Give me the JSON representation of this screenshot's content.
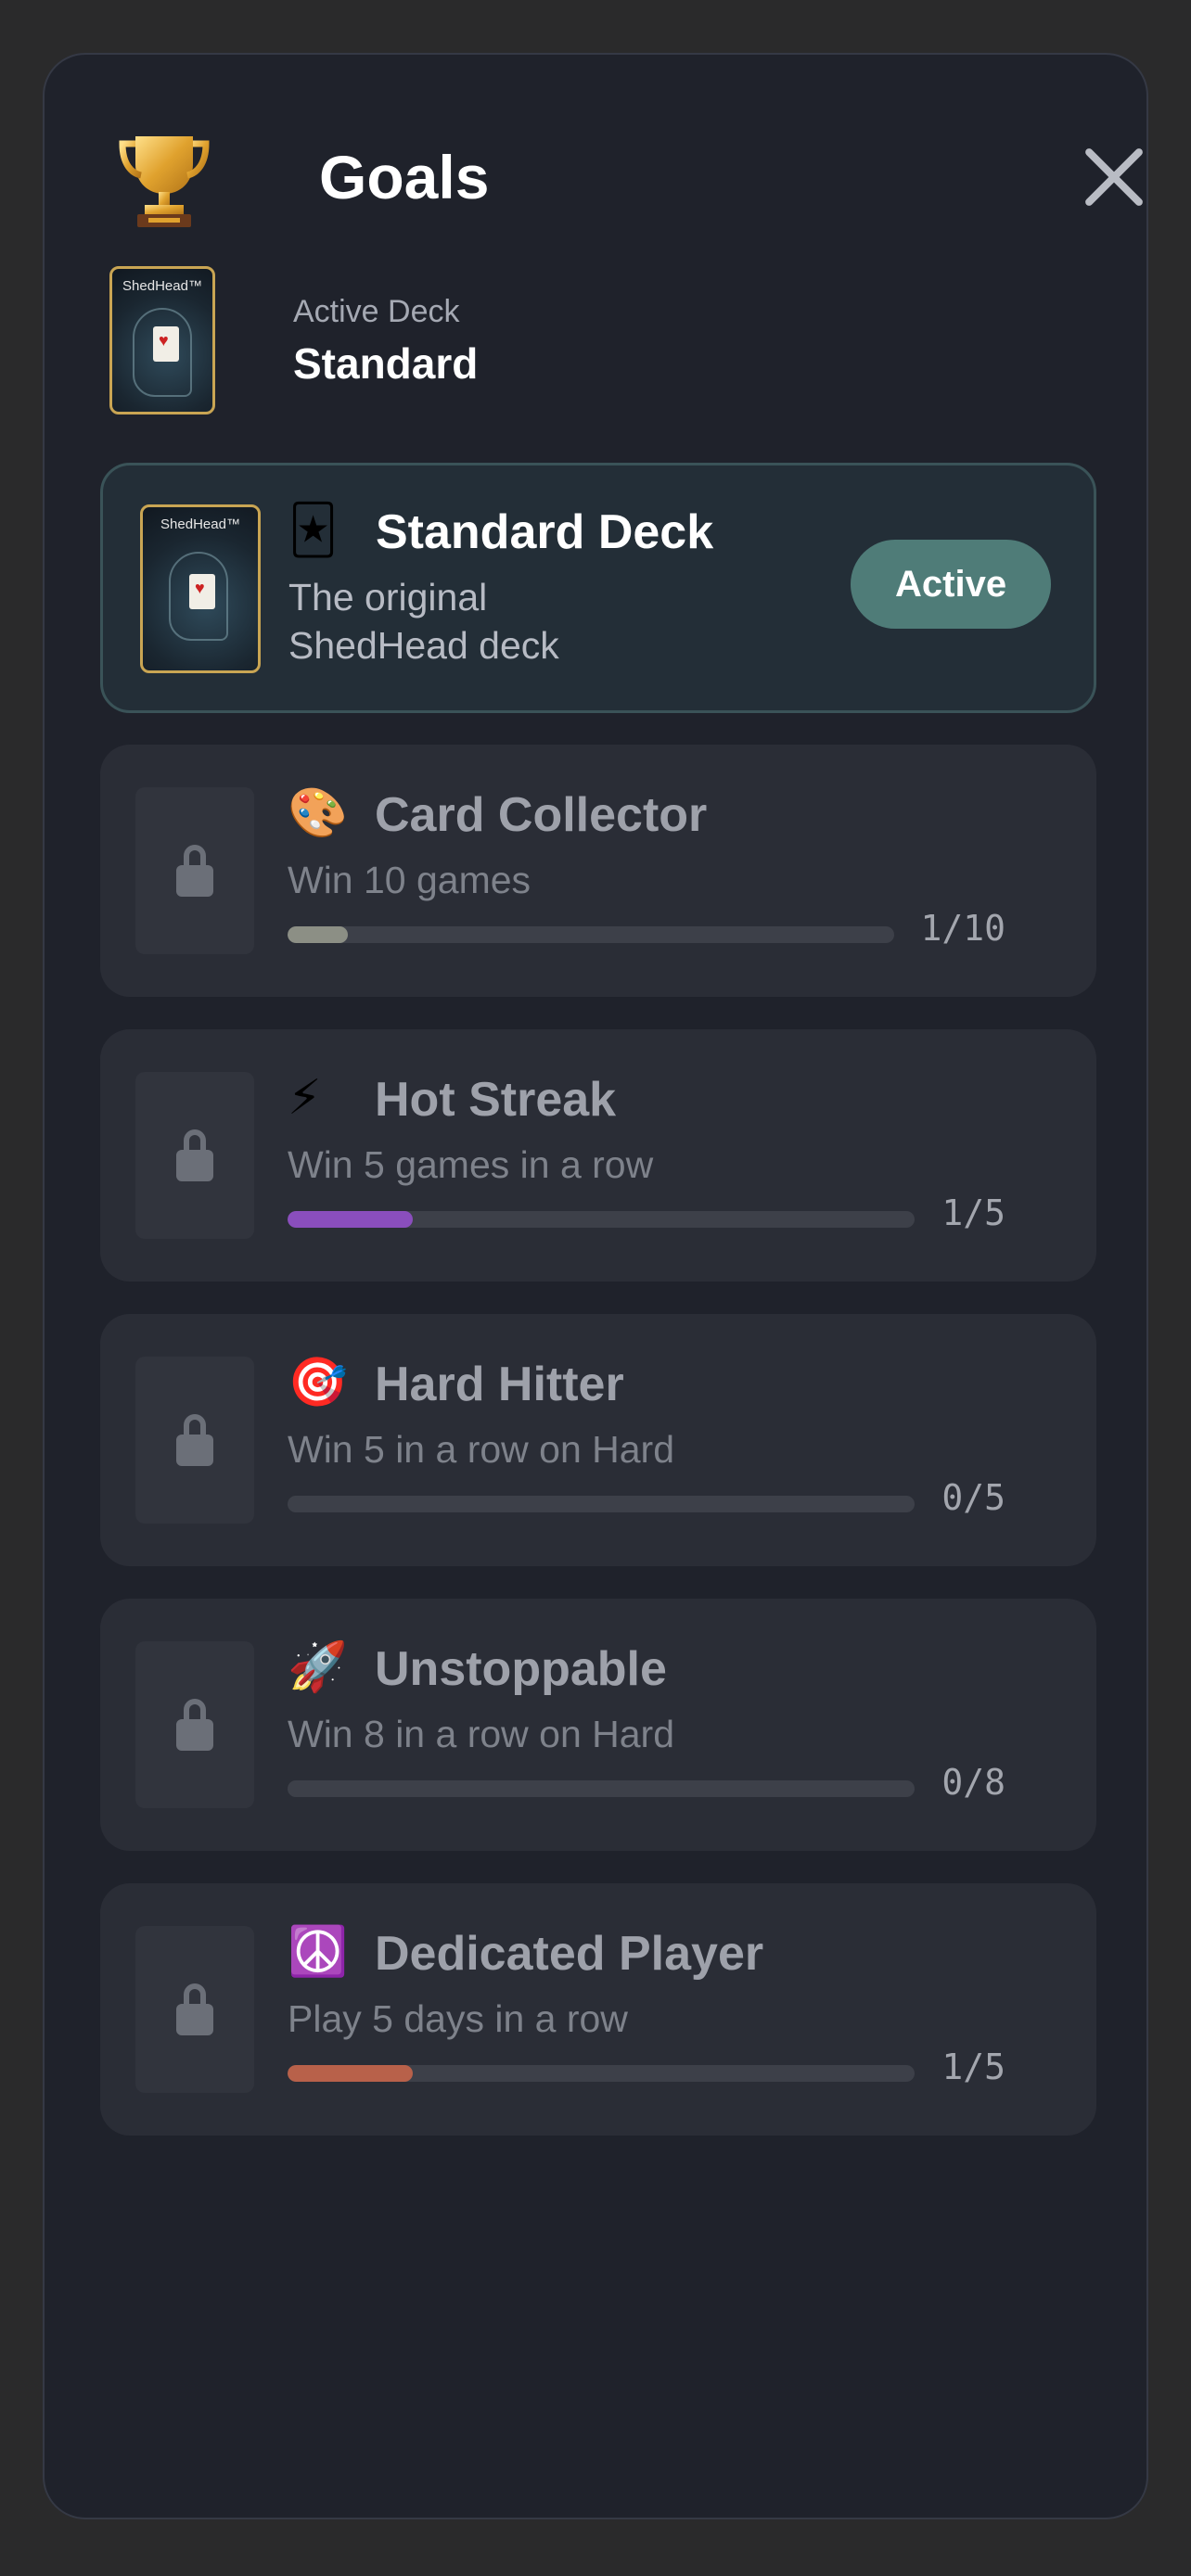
{
  "header": {
    "title": "Goals",
    "trophy_icon": "trophy-icon",
    "close_icon": "close-icon"
  },
  "active_deck": {
    "label": "Active Deck",
    "value": "Standard",
    "thumb_brand": "ShedHead™"
  },
  "decks": [
    {
      "emoji": "🃏",
      "title": "Standard Deck",
      "description_line1": "The original",
      "description_line2": "ShedHead deck",
      "thumb_brand": "ShedHead™",
      "status_label": "Active",
      "active": true
    }
  ],
  "goals": [
    {
      "emoji": "🎨",
      "title": "Card Collector",
      "description": "Win 10 games",
      "progress_text": "1/10",
      "progress": 0.1,
      "color": "#8c8f85",
      "locked": true
    },
    {
      "emoji": "⚡",
      "title": "Hot Streak",
      "description": "Win 5 games in a row",
      "progress_text": "1/5",
      "progress": 0.2,
      "color": "#8a4ebd",
      "locked": true
    },
    {
      "emoji": "🎯",
      "title": "Hard Hitter",
      "description": "Win 5 in a row on Hard",
      "progress_text": "0/5",
      "progress": 0.0,
      "color": "#8a4ebd",
      "locked": true
    },
    {
      "emoji": "🚀",
      "title": "Unstoppable",
      "description": "Win 8 in a row on Hard",
      "progress_text": "0/8",
      "progress": 0.0,
      "color": "#8a4ebd",
      "locked": true
    },
    {
      "emoji": "☮️",
      "title": "Dedicated Player",
      "description": "Play 5 days in a row",
      "progress_text": "1/5",
      "progress": 0.2,
      "color": "#b8614a",
      "locked": true
    }
  ],
  "colors": {
    "sheet_bg": "#1f222b",
    "card_bg": "#2a2d36",
    "active_card_bg": "#232e37",
    "accent": "#4f7c78"
  }
}
